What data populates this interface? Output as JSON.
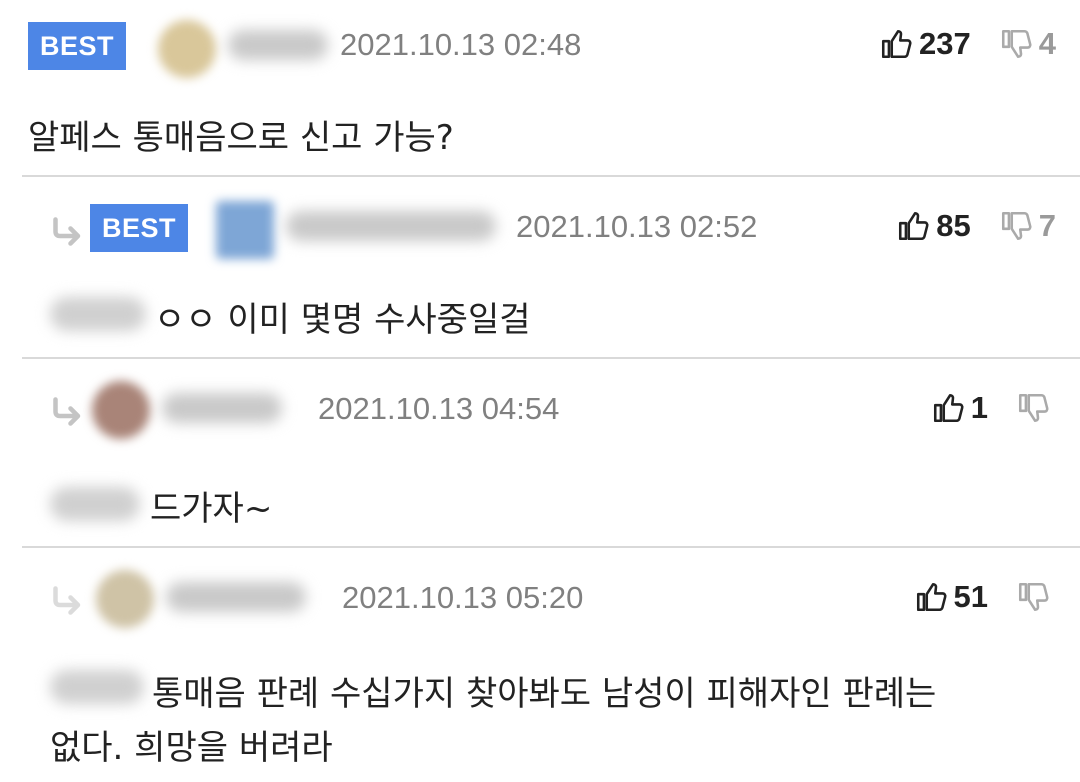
{
  "comments": [
    {
      "badge": "BEST",
      "date": "2021.10.13 02:48",
      "likes": "237",
      "dislikes": "4",
      "text": "알페스 통매음으로 신고 가능?"
    },
    {
      "badge": "BEST",
      "date": "2021.10.13 02:52",
      "likes": "85",
      "dislikes": "7",
      "text": "ㅇㅇ 이미 몇명 수사중일걸"
    },
    {
      "date": "2021.10.13 04:54",
      "likes": "1",
      "text": "드가자~"
    },
    {
      "date": "2021.10.13 05:20",
      "likes": "51",
      "text_line1": "통매음 판례 수십가지 찾아봐도 남성이 피해자인 판례는",
      "text_line2": "없다. 희망을 버려라"
    }
  ],
  "icons": {
    "like": "thumbs-up-icon",
    "dislike": "thumbs-down-icon",
    "reply": "reply-arrow-icon"
  },
  "colors": {
    "best_badge": "#4d86e6",
    "date": "#808080",
    "separator": "#d9d9d9"
  }
}
